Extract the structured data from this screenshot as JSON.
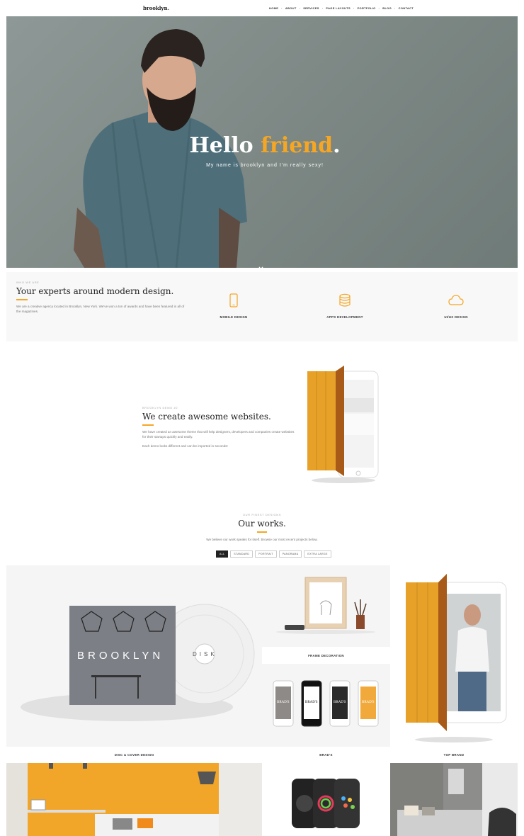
{
  "header": {
    "logo": "brooklyn.",
    "nav": [
      "HOME",
      "ABOUT",
      "SERVICES",
      "PAGE LAYOUTS",
      "PORTFOLIO",
      "BLOG",
      "CONTACT"
    ]
  },
  "hero": {
    "title_main": "Hello ",
    "title_accent": "friend",
    "title_end": ".",
    "subtitle": "My name is brooklyn and I'm really sexy!",
    "scroll_icon": "double-chevron-down-icon"
  },
  "services": {
    "tag": "WHO WE ARE",
    "title": "Your experts around modern design.",
    "text": "We are a creative agency located in Brooklyn, New York. We've won a ton of awards and have been featured in all of the magazines.",
    "items": [
      {
        "label": "MOBILE DESIGN",
        "icon": "smartphone-icon"
      },
      {
        "label": "APPS DEVELOPMENT",
        "icon": "database-icon"
      },
      {
        "label": "UI/UX DESIGN",
        "icon": "cloud-icon"
      }
    ]
  },
  "create": {
    "tag": "BROOKLYN DEMO #2",
    "title": "We create awesome websites.",
    "text": "We have created an awesome theme that will help designers, developers and companies create websites for their startups quickly and easily.",
    "text2": "Each demo looks different and can be imported in seconds!"
  },
  "works": {
    "tag": "OUR FINEST DESIGNS",
    "title": "Our works.",
    "text": "We believe our work speaks for itself. Browse our most recent projects below.",
    "filters": [
      "ALL",
      "STANDARD",
      "PORTRAIT",
      "PANORAMA",
      "EXTRA LARGE"
    ],
    "captions": {
      "disc": "DISC & COVER DESIGN",
      "frame": "FRAME DECORATION",
      "brads": "BRAD'S",
      "top_brand": "TOP BRAND"
    },
    "cover_text": "BROOKLYN",
    "disk_text": "DISK",
    "brads_label": "BRAD'S"
  },
  "colors": {
    "accent": "#f5a623",
    "dark": "#222222"
  }
}
